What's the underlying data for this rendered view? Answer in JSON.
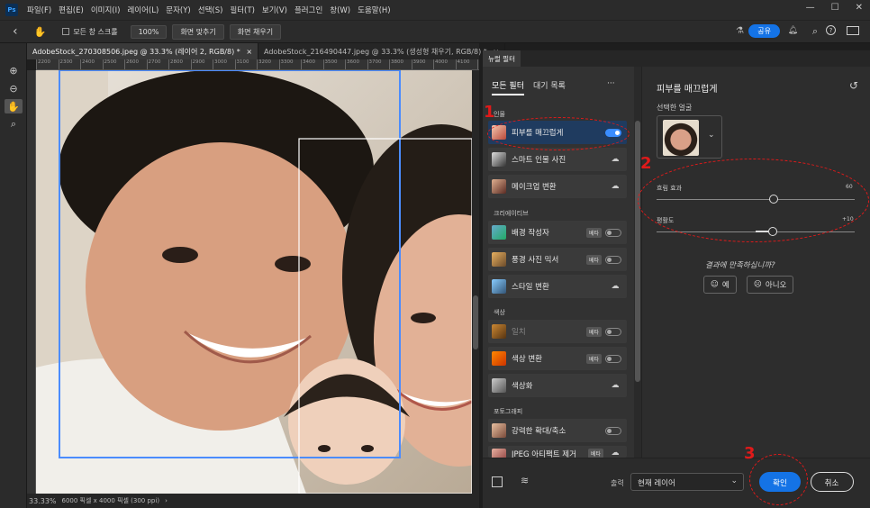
{
  "app": {
    "logo": "Ps"
  },
  "menu": [
    "파일(F)",
    "편집(E)",
    "이미지(I)",
    "레이어(L)",
    "문자(Y)",
    "선택(S)",
    "필터(T)",
    "보기(V)",
    "플러그인",
    "창(W)",
    "도움말(H)"
  ],
  "window_controls": {
    "minimize": "—",
    "maximize": "☐",
    "close": "✕"
  },
  "options": {
    "back": "‹",
    "scroll_all_label": "모든 창 스크롤",
    "zoom_100": "100%",
    "fit_screen": "화면 맞추기",
    "fill_screen": "화면 채우기",
    "share": "공유"
  },
  "doc_tabs": [
    {
      "label": "AdobeStock_270308506.jpeg @ 33.3% (레이어 2, RGB/8) *",
      "close": "×"
    },
    {
      "label": "AdobeStock_216490447.jpeg @ 33.3% (생성형 채우기, RGB/8) *",
      "close": "×"
    }
  ],
  "ruler_ticks": [
    "2200",
    "2300",
    "2400",
    "2500",
    "2600",
    "2700",
    "2800",
    "2900",
    "3000",
    "3100",
    "3200",
    "3300",
    "3400",
    "3500",
    "3600",
    "3700",
    "3800",
    "3900",
    "4000",
    "4100",
    "4200",
    "430"
  ],
  "status": {
    "zoom": "33.33%",
    "doc_info": "6000 픽셀 x 4000 픽셀 (300 ppi)",
    "arrow": "›"
  },
  "neural": {
    "panel_tab": "뉴럴 필터",
    "tab_all": "모든 필터",
    "tab_waitlist": "대기 목록",
    "more": "···",
    "categories": {
      "portrait": "인물",
      "creative": "크리에이티브",
      "color": "색상",
      "photography": "포토그래피"
    },
    "filters": [
      {
        "name": "피부를 매끄럽게",
        "control": "toggle-on"
      },
      {
        "name": "스마트 인물 사진",
        "control": "cloud"
      },
      {
        "name": "메이크업 변환",
        "control": "cloud"
      },
      {
        "name": "배경 작성자",
        "badge": "베타",
        "control": "toggle"
      },
      {
        "name": "풍경 사진 믹서",
        "badge": "베타",
        "control": "toggle"
      },
      {
        "name": "스타일 변환",
        "control": "cloud"
      },
      {
        "name": "일치",
        "badge": "베타",
        "control": "toggle",
        "dim": true
      },
      {
        "name": "색상 변환",
        "badge": "베타",
        "control": "toggle"
      },
      {
        "name": "색상화",
        "control": "cloud"
      },
      {
        "name": "강력한 확대/축소",
        "control": "toggle"
      },
      {
        "name": "JPEG 아티팩트 제거",
        "badge": "베타",
        "control": "cloud"
      }
    ],
    "detail": {
      "title": "피부를 매끄럽게",
      "reset": "↺",
      "selected_face_label": "선택한 얼굴",
      "blur_label": "흐림 효과",
      "blur_value": "60",
      "smooth_label": "평활도",
      "smooth_value": "+10",
      "feedback_question": "결과에 만족하십니까?",
      "yes": "예",
      "no": "아니오"
    },
    "output_label": "출력",
    "output_value": "현재 레이어",
    "ok": "확인",
    "cancel": "취소"
  },
  "annotations": [
    "1",
    "2",
    "3"
  ]
}
